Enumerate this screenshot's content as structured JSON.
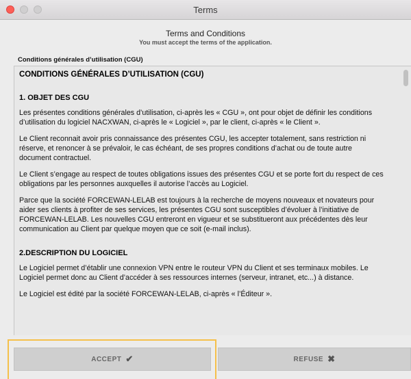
{
  "window": {
    "title": "Terms"
  },
  "header": {
    "title": "Terms and Conditions",
    "subtitle": "You must accept the terms of the application."
  },
  "cgu_label": "Conditions générales d’utilisation (CGU)",
  "document": {
    "heading": "CONDITIONS GÉNÉRALES D’UTILISATION (CGU)",
    "section1_title": "1. OBJET DES CGU",
    "p1": "Les présentes conditions générales d’utilisation, ci-après les « CGU », ont pour objet de définir les conditions d’utilisation du logiciel NACXWAN, ci-après le « Logiciel », par le client, ci-après « le Client ».",
    "p2": "Le Client reconnait avoir pris connaissance des présentes CGU, les accepter totalement, sans restriction ni réserve, et renoncer à se prévaloir, le cas échéant, de ses propres conditions d’achat ou de toute autre document contractuel.",
    "p3": "Le Client s’engage au respect de toutes obligations issues des présentes CGU et se porte fort du respect de ces obligations par les personnes auxquelles il autorise l’accès au Logiciel.",
    "p4": "Parce que la société FORCEWAN-LELAB est toujours à la recherche de moyens nouveaux et novateurs pour aider ses clients à profiter de ses services, les présentes CGU sont susceptibles d’évoluer à l’initiative de FORCEWAN-LELAB. Les nouvelles CGU entreront en vigueur et se substitueront aux précédentes dès leur communication au Client par quelque moyen que ce soit (e-mail inclus).",
    "section2_title": "2.DESCRIPTION DU LOGICIEL",
    "p5": "Le Logiciel permet d’établir une connexion VPN entre le routeur VPN du Client et ses terminaux mobiles. Le Logiciel permet donc au Client d’accéder à ses ressources internes (serveur, intranet, etc...) à distance.",
    "p6": "Le Logiciel est édité par la société FORCEWAN-LELAB, ci-après « l’Éditeur »."
  },
  "buttons": {
    "accept_label": "ACCEPT",
    "accept_icon": "checkmark-icon",
    "refuse_label": "REFUSE",
    "refuse_icon": "x-icon"
  },
  "colors": {
    "focus_ring": "#f5c04a",
    "close_light": "#fd5f57"
  }
}
